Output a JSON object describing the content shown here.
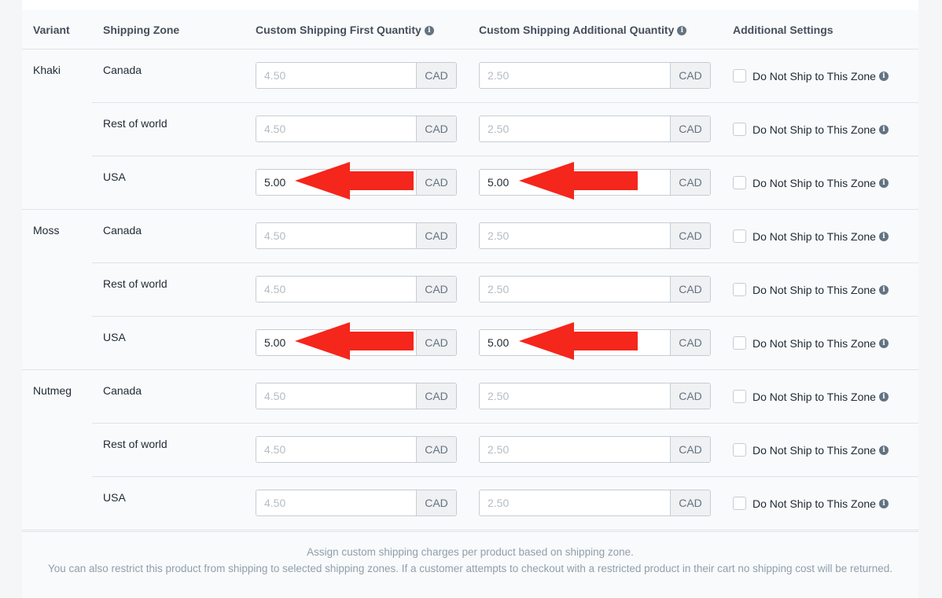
{
  "headers": {
    "variant": "Variant",
    "zone": "Shipping Zone",
    "first": "Custom Shipping First Quantity",
    "additional": "Custom Shipping Additional Quantity",
    "settings": "Additional Settings"
  },
  "currency": "CAD",
  "checkbox_label": "Do Not Ship to This Zone",
  "rows": [
    {
      "variant": "Khaki",
      "zone": "Canada",
      "first_value": "",
      "first_placeholder": "4.50",
      "add_value": "",
      "add_placeholder": "2.50",
      "checked": false,
      "arrow": false
    },
    {
      "variant": "",
      "zone": "Rest of world",
      "first_value": "",
      "first_placeholder": "4.50",
      "add_value": "",
      "add_placeholder": "2.50",
      "checked": false,
      "arrow": false
    },
    {
      "variant": "",
      "zone": "USA",
      "first_value": "5.00",
      "first_placeholder": "4.50",
      "add_value": "5.00",
      "add_placeholder": "2.50",
      "checked": false,
      "arrow": true
    },
    {
      "variant": "Moss",
      "zone": "Canada",
      "first_value": "",
      "first_placeholder": "4.50",
      "add_value": "",
      "add_placeholder": "2.50",
      "checked": false,
      "arrow": false
    },
    {
      "variant": "",
      "zone": "Rest of world",
      "first_value": "",
      "first_placeholder": "4.50",
      "add_value": "",
      "add_placeholder": "2.50",
      "checked": false,
      "arrow": false
    },
    {
      "variant": "",
      "zone": "USA",
      "first_value": "5.00",
      "first_placeholder": "4.50",
      "add_value": "5.00",
      "add_placeholder": "2.50",
      "checked": false,
      "arrow": true
    },
    {
      "variant": "Nutmeg",
      "zone": "Canada",
      "first_value": "",
      "first_placeholder": "4.50",
      "add_value": "",
      "add_placeholder": "2.50",
      "checked": false,
      "arrow": false
    },
    {
      "variant": "",
      "zone": "Rest of world",
      "first_value": "",
      "first_placeholder": "4.50",
      "add_value": "",
      "add_placeholder": "2.50",
      "checked": false,
      "arrow": false
    },
    {
      "variant": "",
      "zone": "USA",
      "first_value": "",
      "first_placeholder": "4.50",
      "add_value": "",
      "add_placeholder": "2.50",
      "checked": false,
      "arrow": false
    }
  ],
  "footer": {
    "line1": "Assign custom shipping charges per product based on shipping zone.",
    "line2": "You can also restrict this product from shipping to selected shipping zones. If a customer attempts to checkout with a restricted product in their cart no shipping cost will be returned."
  },
  "colors": {
    "arrow": "#f5261c"
  }
}
